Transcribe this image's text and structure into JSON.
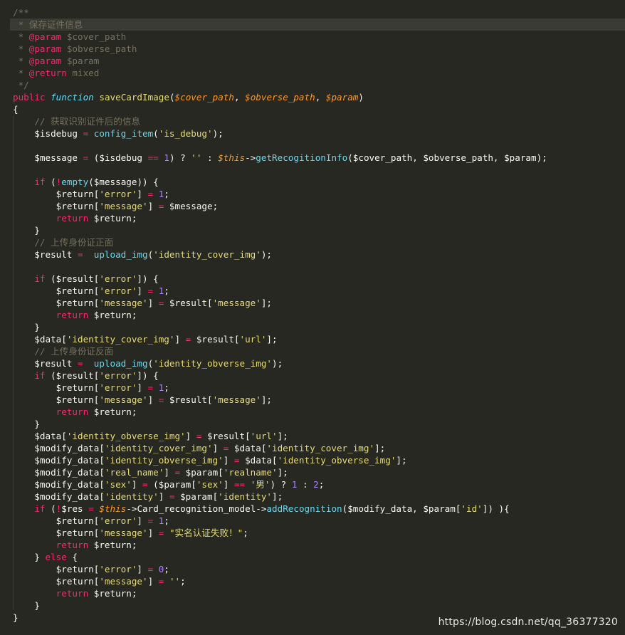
{
  "code_lines": [
    [
      {
        "t": "/**",
        "c": "c"
      }
    ],
    [
      {
        "t": " * 保存证件信息",
        "c": "c"
      }
    ],
    [
      {
        "t": " * ",
        "c": "c"
      },
      {
        "t": "@param",
        "c": "ann"
      },
      {
        "t": " $cover_path",
        "c": "c"
      }
    ],
    [
      {
        "t": " * ",
        "c": "c"
      },
      {
        "t": "@param",
        "c": "ann"
      },
      {
        "t": " $obverse_path",
        "c": "c"
      }
    ],
    [
      {
        "t": " * ",
        "c": "c"
      },
      {
        "t": "@param",
        "c": "ann"
      },
      {
        "t": " $param",
        "c": "c"
      }
    ],
    [
      {
        "t": " * ",
        "c": "c"
      },
      {
        "t": "@return",
        "c": "ann"
      },
      {
        "t": " mixed",
        "c": "c"
      }
    ],
    [
      {
        "t": " */",
        "c": "c"
      }
    ],
    [
      {
        "t": "public",
        "c": "k"
      },
      {
        "t": " ",
        "c": "p"
      },
      {
        "t": "function",
        "c": "fi"
      },
      {
        "t": " ",
        "c": "p"
      },
      {
        "t": "saveCardImage",
        "c": "s"
      },
      {
        "t": "(",
        "c": "p"
      },
      {
        "t": "$cover_path",
        "c": "vi"
      },
      {
        "t": ", ",
        "c": "p"
      },
      {
        "t": "$obverse_path",
        "c": "vi"
      },
      {
        "t": ", ",
        "c": "p"
      },
      {
        "t": "$param",
        "c": "vi"
      },
      {
        "t": ")",
        "c": "p"
      }
    ],
    [
      {
        "t": "{",
        "c": "p"
      }
    ],
    [
      {
        "t": "    ",
        "c": "p"
      },
      {
        "t": "// 获取识别证件后的信息",
        "c": "c"
      }
    ],
    [
      {
        "t": "    $isdebug ",
        "c": "v"
      },
      {
        "t": "=",
        "c": "k"
      },
      {
        "t": " ",
        "c": "p"
      },
      {
        "t": "config_item",
        "c": "f"
      },
      {
        "t": "(",
        "c": "p"
      },
      {
        "t": "'is_debug'",
        "c": "s"
      },
      {
        "t": ");",
        "c": "p"
      }
    ],
    [
      {
        "t": "",
        "c": "p"
      }
    ],
    [
      {
        "t": "    $message ",
        "c": "v"
      },
      {
        "t": "=",
        "c": "k"
      },
      {
        "t": " ($isdebug ",
        "c": "p"
      },
      {
        "t": "==",
        "c": "k"
      },
      {
        "t": " ",
        "c": "p"
      },
      {
        "t": "1",
        "c": "n"
      },
      {
        "t": ") ? ",
        "c": "p"
      },
      {
        "t": "''",
        "c": "s"
      },
      {
        "t": " : ",
        "c": "p"
      },
      {
        "t": "$this",
        "c": "th"
      },
      {
        "t": "->",
        "c": "p"
      },
      {
        "t": "getRecogitionInfo",
        "c": "f"
      },
      {
        "t": "($cover_path, $obverse_path, $param);",
        "c": "p"
      }
    ],
    [
      {
        "t": "",
        "c": "p"
      }
    ],
    [
      {
        "t": "    ",
        "c": "p"
      },
      {
        "t": "if",
        "c": "k"
      },
      {
        "t": " (",
        "c": "p"
      },
      {
        "t": "!",
        "c": "k"
      },
      {
        "t": "empty",
        "c": "f"
      },
      {
        "t": "($message)) {",
        "c": "p"
      }
    ],
    [
      {
        "t": "        $return[",
        "c": "p"
      },
      {
        "t": "'error'",
        "c": "s"
      },
      {
        "t": "] ",
        "c": "p"
      },
      {
        "t": "=",
        "c": "k"
      },
      {
        "t": " ",
        "c": "p"
      },
      {
        "t": "1",
        "c": "n"
      },
      {
        "t": ";",
        "c": "p"
      }
    ],
    [
      {
        "t": "        $return[",
        "c": "p"
      },
      {
        "t": "'message'",
        "c": "s"
      },
      {
        "t": "] ",
        "c": "p"
      },
      {
        "t": "=",
        "c": "k"
      },
      {
        "t": " $message;",
        "c": "p"
      }
    ],
    [
      {
        "t": "        ",
        "c": "p"
      },
      {
        "t": "return",
        "c": "k"
      },
      {
        "t": " $return;",
        "c": "p"
      }
    ],
    [
      {
        "t": "    }",
        "c": "p"
      }
    ],
    [
      {
        "t": "    ",
        "c": "p"
      },
      {
        "t": "// 上传身份证正面",
        "c": "c"
      }
    ],
    [
      {
        "t": "    $result ",
        "c": "v"
      },
      {
        "t": "=",
        "c": "k"
      },
      {
        "t": "  ",
        "c": "p"
      },
      {
        "t": "upload_img",
        "c": "f"
      },
      {
        "t": "(",
        "c": "p"
      },
      {
        "t": "'identity_cover_img'",
        "c": "s"
      },
      {
        "t": ");",
        "c": "p"
      }
    ],
    [
      {
        "t": "",
        "c": "p"
      }
    ],
    [
      {
        "t": "    ",
        "c": "p"
      },
      {
        "t": "if",
        "c": "k"
      },
      {
        "t": " ($result[",
        "c": "p"
      },
      {
        "t": "'error'",
        "c": "s"
      },
      {
        "t": "]) {",
        "c": "p"
      }
    ],
    [
      {
        "t": "        $return[",
        "c": "p"
      },
      {
        "t": "'error'",
        "c": "s"
      },
      {
        "t": "] ",
        "c": "p"
      },
      {
        "t": "=",
        "c": "k"
      },
      {
        "t": " ",
        "c": "p"
      },
      {
        "t": "1",
        "c": "n"
      },
      {
        "t": ";",
        "c": "p"
      }
    ],
    [
      {
        "t": "        $return[",
        "c": "p"
      },
      {
        "t": "'message'",
        "c": "s"
      },
      {
        "t": "] ",
        "c": "p"
      },
      {
        "t": "=",
        "c": "k"
      },
      {
        "t": " $result[",
        "c": "p"
      },
      {
        "t": "'message'",
        "c": "s"
      },
      {
        "t": "];",
        "c": "p"
      }
    ],
    [
      {
        "t": "        ",
        "c": "p"
      },
      {
        "t": "return",
        "c": "k"
      },
      {
        "t": " $return;",
        "c": "p"
      }
    ],
    [
      {
        "t": "    }",
        "c": "p"
      }
    ],
    [
      {
        "t": "    $data[",
        "c": "p"
      },
      {
        "t": "'identity_cover_img'",
        "c": "s"
      },
      {
        "t": "] ",
        "c": "p"
      },
      {
        "t": "=",
        "c": "k"
      },
      {
        "t": " $result[",
        "c": "p"
      },
      {
        "t": "'url'",
        "c": "s"
      },
      {
        "t": "];",
        "c": "p"
      }
    ],
    [
      {
        "t": "    ",
        "c": "p"
      },
      {
        "t": "// 上传身份证反面",
        "c": "c"
      }
    ],
    [
      {
        "t": "    $result ",
        "c": "v"
      },
      {
        "t": "=",
        "c": "k"
      },
      {
        "t": "  ",
        "c": "p"
      },
      {
        "t": "upload_img",
        "c": "f"
      },
      {
        "t": "(",
        "c": "p"
      },
      {
        "t": "'identity_obverse_img'",
        "c": "s"
      },
      {
        "t": ");",
        "c": "p"
      }
    ],
    [
      {
        "t": "    ",
        "c": "p"
      },
      {
        "t": "if",
        "c": "k"
      },
      {
        "t": " ($result[",
        "c": "p"
      },
      {
        "t": "'error'",
        "c": "s"
      },
      {
        "t": "]) {",
        "c": "p"
      }
    ],
    [
      {
        "t": "        $return[",
        "c": "p"
      },
      {
        "t": "'error'",
        "c": "s"
      },
      {
        "t": "] ",
        "c": "p"
      },
      {
        "t": "=",
        "c": "k"
      },
      {
        "t": " ",
        "c": "p"
      },
      {
        "t": "1",
        "c": "n"
      },
      {
        "t": ";",
        "c": "p"
      }
    ],
    [
      {
        "t": "        $return[",
        "c": "p"
      },
      {
        "t": "'message'",
        "c": "s"
      },
      {
        "t": "] ",
        "c": "p"
      },
      {
        "t": "=",
        "c": "k"
      },
      {
        "t": " $result[",
        "c": "p"
      },
      {
        "t": "'message'",
        "c": "s"
      },
      {
        "t": "];",
        "c": "p"
      }
    ],
    [
      {
        "t": "        ",
        "c": "p"
      },
      {
        "t": "return",
        "c": "k"
      },
      {
        "t": " $return;",
        "c": "p"
      }
    ],
    [
      {
        "t": "    }",
        "c": "p"
      }
    ],
    [
      {
        "t": "    $data[",
        "c": "p"
      },
      {
        "t": "'identity_obverse_img'",
        "c": "s"
      },
      {
        "t": "] ",
        "c": "p"
      },
      {
        "t": "=",
        "c": "k"
      },
      {
        "t": " $result[",
        "c": "p"
      },
      {
        "t": "'url'",
        "c": "s"
      },
      {
        "t": "];",
        "c": "p"
      }
    ],
    [
      {
        "t": "    $modify_data[",
        "c": "p"
      },
      {
        "t": "'identity_cover_img'",
        "c": "s"
      },
      {
        "t": "] ",
        "c": "p"
      },
      {
        "t": "=",
        "c": "k"
      },
      {
        "t": " $data[",
        "c": "p"
      },
      {
        "t": "'identity_cover_img'",
        "c": "s"
      },
      {
        "t": "];",
        "c": "p"
      }
    ],
    [
      {
        "t": "    $modify_data[",
        "c": "p"
      },
      {
        "t": "'identity_obverse_img'",
        "c": "s"
      },
      {
        "t": "] ",
        "c": "p"
      },
      {
        "t": "=",
        "c": "k"
      },
      {
        "t": " $data[",
        "c": "p"
      },
      {
        "t": "'identity_obverse_img'",
        "c": "s"
      },
      {
        "t": "];",
        "c": "p"
      }
    ],
    [
      {
        "t": "    $modify_data[",
        "c": "p"
      },
      {
        "t": "'real_name'",
        "c": "s"
      },
      {
        "t": "] ",
        "c": "p"
      },
      {
        "t": "=",
        "c": "k"
      },
      {
        "t": " $param[",
        "c": "p"
      },
      {
        "t": "'realname'",
        "c": "s"
      },
      {
        "t": "];",
        "c": "p"
      }
    ],
    [
      {
        "t": "    $modify_data[",
        "c": "p"
      },
      {
        "t": "'sex'",
        "c": "s"
      },
      {
        "t": "] ",
        "c": "p"
      },
      {
        "t": "=",
        "c": "k"
      },
      {
        "t": " ($param[",
        "c": "p"
      },
      {
        "t": "'sex'",
        "c": "s"
      },
      {
        "t": "] ",
        "c": "p"
      },
      {
        "t": "==",
        "c": "k"
      },
      {
        "t": " ",
        "c": "p"
      },
      {
        "t": "'男'",
        "c": "s"
      },
      {
        "t": ") ? ",
        "c": "p"
      },
      {
        "t": "1",
        "c": "n"
      },
      {
        "t": " : ",
        "c": "p"
      },
      {
        "t": "2",
        "c": "n"
      },
      {
        "t": ";",
        "c": "p"
      }
    ],
    [
      {
        "t": "    $modify_data[",
        "c": "p"
      },
      {
        "t": "'identity'",
        "c": "s"
      },
      {
        "t": "] ",
        "c": "p"
      },
      {
        "t": "=",
        "c": "k"
      },
      {
        "t": " $param[",
        "c": "p"
      },
      {
        "t": "'identity'",
        "c": "s"
      },
      {
        "t": "];",
        "c": "p"
      }
    ],
    [
      {
        "t": "    ",
        "c": "p"
      },
      {
        "t": "if",
        "c": "k"
      },
      {
        "t": " (",
        "c": "p"
      },
      {
        "t": "!",
        "c": "k"
      },
      {
        "t": "$res ",
        "c": "p"
      },
      {
        "t": "=",
        "c": "k"
      },
      {
        "t": " ",
        "c": "p"
      },
      {
        "t": "$this",
        "c": "th"
      },
      {
        "t": "->Card_recognition_model->",
        "c": "p"
      },
      {
        "t": "addRecognition",
        "c": "f"
      },
      {
        "t": "($modify_data, $param[",
        "c": "p"
      },
      {
        "t": "'id'",
        "c": "s"
      },
      {
        "t": "]) ){",
        "c": "p"
      }
    ],
    [
      {
        "t": "        $return[",
        "c": "p"
      },
      {
        "t": "'error'",
        "c": "s"
      },
      {
        "t": "] ",
        "c": "p"
      },
      {
        "t": "=",
        "c": "k"
      },
      {
        "t": " ",
        "c": "p"
      },
      {
        "t": "1",
        "c": "n"
      },
      {
        "t": ";",
        "c": "p"
      }
    ],
    [
      {
        "t": "        $return[",
        "c": "p"
      },
      {
        "t": "'message'",
        "c": "s"
      },
      {
        "t": "] ",
        "c": "p"
      },
      {
        "t": "=",
        "c": "k"
      },
      {
        "t": " ",
        "c": "p"
      },
      {
        "t": "\"实名认证失败！\"",
        "c": "s"
      },
      {
        "t": ";",
        "c": "p"
      }
    ],
    [
      {
        "t": "        ",
        "c": "p"
      },
      {
        "t": "return",
        "c": "k"
      },
      {
        "t": " $return;",
        "c": "p"
      }
    ],
    [
      {
        "t": "    } ",
        "c": "p"
      },
      {
        "t": "else",
        "c": "k"
      },
      {
        "t": " {",
        "c": "p"
      }
    ],
    [
      {
        "t": "        $return[",
        "c": "p"
      },
      {
        "t": "'error'",
        "c": "s"
      },
      {
        "t": "] ",
        "c": "p"
      },
      {
        "t": "=",
        "c": "k"
      },
      {
        "t": " ",
        "c": "p"
      },
      {
        "t": "0",
        "c": "n"
      },
      {
        "t": ";",
        "c": "p"
      }
    ],
    [
      {
        "t": "        $return[",
        "c": "p"
      },
      {
        "t": "'message'",
        "c": "s"
      },
      {
        "t": "] ",
        "c": "p"
      },
      {
        "t": "=",
        "c": "k"
      },
      {
        "t": " ",
        "c": "p"
      },
      {
        "t": "''",
        "c": "s"
      },
      {
        "t": ";",
        "c": "p"
      }
    ],
    [
      {
        "t": "        ",
        "c": "p"
      },
      {
        "t": "return",
        "c": "k"
      },
      {
        "t": " $return;",
        "c": "p"
      }
    ],
    [
      {
        "t": "    }",
        "c": "p"
      }
    ],
    [
      {
        "t": "}",
        "c": "p"
      }
    ]
  ],
  "highlighted_line": 1,
  "watermark": "https://blog.csdn.net/qq_36377320",
  "colors": {
    "background": "#272822",
    "comment": "#75715e",
    "keyword": "#f92672",
    "string": "#e6db74",
    "number": "#ae81ff",
    "function": "#66d9ef",
    "parameter": "#fd971f",
    "text": "#f8f8f2"
  }
}
